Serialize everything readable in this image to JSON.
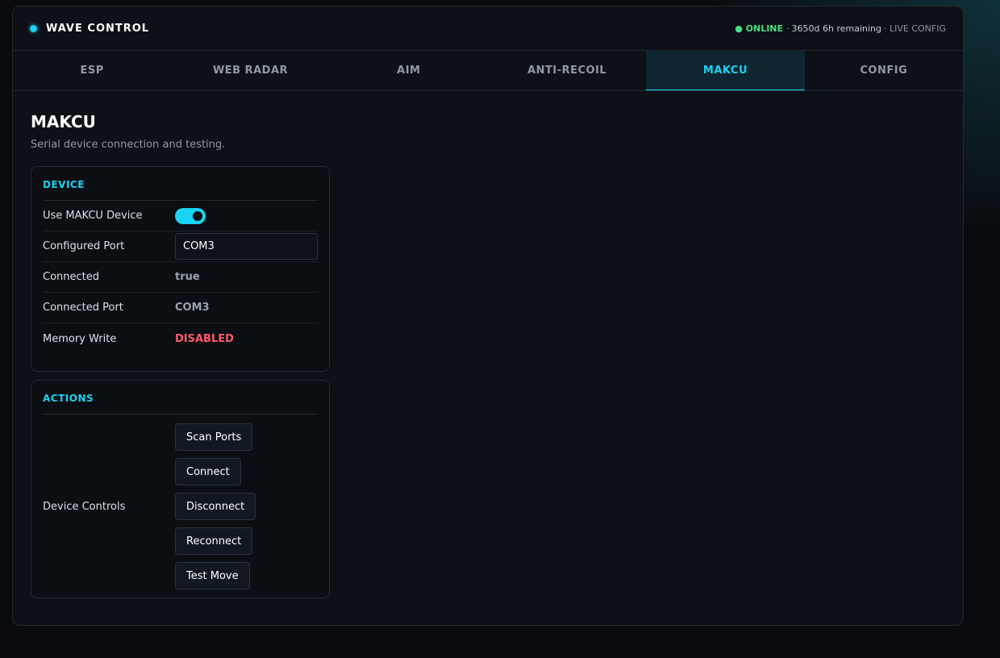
{
  "app": {
    "title": "WAVE CONTROL",
    "accent_color": "#19d3f3"
  },
  "status": {
    "online": "● ONLINE",
    "separator": "·",
    "remaining": "3650d 6h remaining",
    "live": "· LIVE CONFIG",
    "online_color": "#4ade80"
  },
  "tabs": [
    {
      "label": "ESP",
      "active": false
    },
    {
      "label": "WEB RADAR",
      "active": false
    },
    {
      "label": "AIM",
      "active": false
    },
    {
      "label": "ANTI-RECOIL",
      "active": false
    },
    {
      "label": "MAKCU",
      "active": true
    },
    {
      "label": "CONFIG",
      "active": false
    }
  ],
  "page": {
    "title": "MAKCU",
    "subtitle": "Serial device connection and testing."
  },
  "device": {
    "heading": "DEVICE",
    "use_label": "Use MAKCU Device",
    "use_enabled": true,
    "port_label": "Configured Port",
    "port_value": "COM3",
    "connected_label": "Connected",
    "connected_value": "true",
    "connected_port_label": "Connected Port",
    "connected_port_value": "COM3",
    "memory_label": "Memory Write",
    "memory_value": "DISABLED",
    "danger_color": "#ff5a6a"
  },
  "actions": {
    "heading": "ACTIONS",
    "controls_label": "Device Controls",
    "buttons": {
      "scan": "Scan Ports",
      "connect": "Connect",
      "disconnect": "Disconnect",
      "reconnect": "Reconnect",
      "test": "Test Move"
    }
  }
}
